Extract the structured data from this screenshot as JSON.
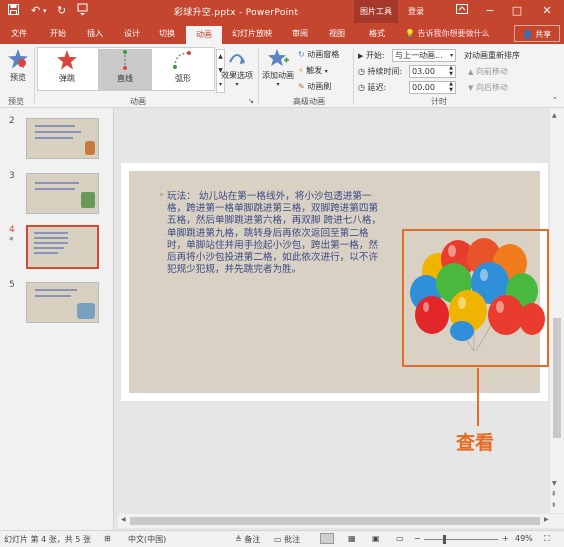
{
  "titlebar": {
    "title": "彩球升空.pptx  -  PowerPoint",
    "context_tab": "图片工具",
    "login": "登录",
    "save_icon": "save-icon",
    "undo_glyph": "↶",
    "redo_glyph": "↻",
    "win_min": "−",
    "win_max": "□",
    "win_close": "✕"
  },
  "tabs": [
    "文件",
    "开始",
    "插入",
    "设计",
    "切换",
    "动画",
    "幻灯片放映",
    "审阅",
    "视图",
    "格式"
  ],
  "tell_me": "告诉我你想要做什么",
  "share": "共享",
  "ribbon": {
    "preview": "预览",
    "preview_group": "预览",
    "animation_group": "动画",
    "gallery": [
      "弹跳",
      "直线",
      "弧形"
    ],
    "effect_options": "效果选项",
    "add_animation": "添加动画",
    "animation_pane": "动画窗格",
    "trigger": "触发",
    "animation_painter": "动画刷",
    "advanced_group": "高级动画",
    "start_label": "开始:",
    "start_value": "与上一动画...",
    "duration_label": "持续时间:",
    "duration_value": "03.00",
    "delay_label": "延迟:",
    "delay_value": "00.00",
    "timing_group": "计时",
    "reorder_title": "对动画重新排序",
    "move_earlier": "向前移动",
    "move_later": "向后移动"
  },
  "thumbnails": [
    {
      "num": "2",
      "star": ""
    },
    {
      "num": "3",
      "star": ""
    },
    {
      "num": "4",
      "star": "*"
    },
    {
      "num": "5",
      "star": ""
    }
  ],
  "slide_text": "玩法： 幼儿站在第一格线外，将小沙包透进第一格，跨进第一格单脚跳进第三格，双脚跨进第四第五格，然后单脚跳进第六格，再双脚 跨进七八格，单脚跳进第九格，跳转身后再依次返回至第二格时，单脚站住并用手捡起小沙包，跨出第一格，然后再将小沙包投进第二格，如此依次进行，以不许犯规少犯规，并先跳完者为胜。",
  "callout": "查看",
  "status": {
    "slide_info": "幻灯片 第 4 张，共 5 张",
    "language": "中文(中国)",
    "notes": "备注",
    "comments": "批注",
    "zoom": "49%",
    "zoom_minus": "−",
    "zoom_plus": "+"
  },
  "colors": {
    "accent": "#c4462f",
    "callout": "#e46c22",
    "slide_bg": "#d9d1c3",
    "text": "#3a4a86"
  }
}
